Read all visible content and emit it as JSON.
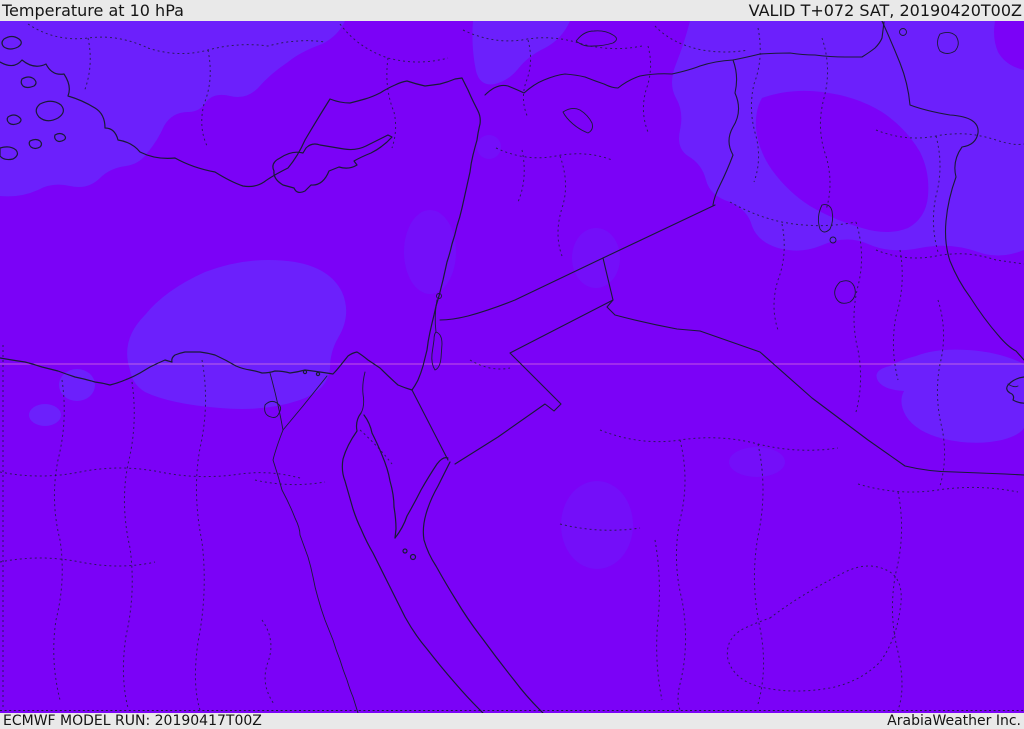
{
  "header": {
    "title": "Temperature at 10 hPa",
    "valid_label": "VALID T+072 SAT, 20190420T00Z"
  },
  "footer": {
    "model_run_label": "ECMWF MODEL RUN: 20190417T00Z",
    "brand_label": "ArabiaWeather Inc."
  },
  "map": {
    "product": "Temperature at 10 hPa",
    "region": "Eastern Mediterranean / Middle East",
    "colors": {
      "base": "#7b02f7",
      "shade": "#6c20fc",
      "line": "#1a1a38",
      "grid": "#ff9ad2",
      "bar": "#e9e9e9",
      "text": "#151515"
    },
    "features": [
      "temperature-shading",
      "coastlines",
      "country-borders",
      "admin-boundaries",
      "rivers",
      "lakes",
      "latitude-gridline"
    ]
  }
}
